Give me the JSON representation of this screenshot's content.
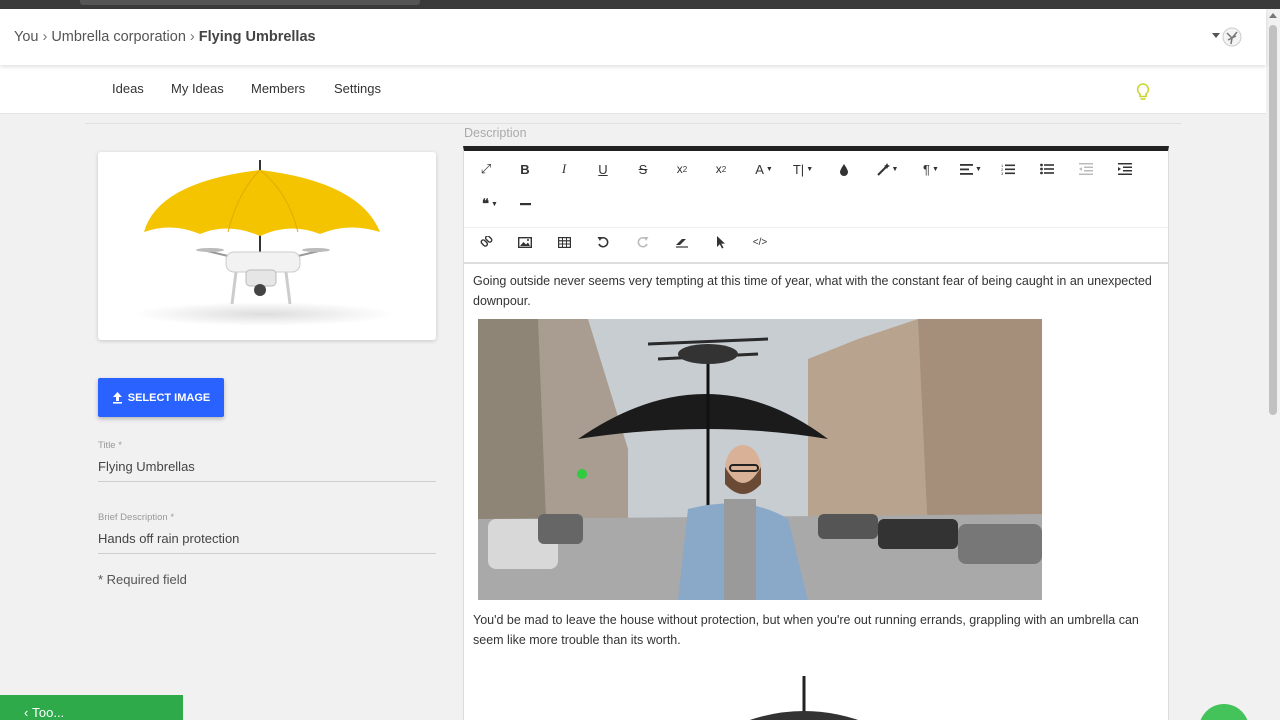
{
  "breadcrumb": {
    "items": [
      "You",
      "Umbrella corporation"
    ],
    "separator": "›",
    "current": "Flying Umbrellas"
  },
  "tabs": [
    {
      "label": "Ideas"
    },
    {
      "label": "My Ideas"
    },
    {
      "label": "Members"
    },
    {
      "label": "Settings"
    }
  ],
  "form": {
    "select_image_label": "SELECT IMAGE",
    "title": {
      "label": "Title *",
      "value": "Flying Umbrellas"
    },
    "brief": {
      "label": "Brief Description *",
      "value": "Hands off rain protection"
    },
    "required_note": "* Required field"
  },
  "editor": {
    "label": "Description",
    "paragraph1": "Going outside never seems very tempting at this time of year, what with the constant fear of being caught in an unexpected downpour.",
    "paragraph2": "You'd be mad to leave the house without protection, but when you're out running errands, grappling with an umbrella can seem like more trouble than its worth."
  },
  "bottom": {
    "green_button_label": "‹  Тоо..."
  },
  "colors": {
    "primary": "#2962ff",
    "accent_green": "#2eaa4b",
    "bulb": "#c6d62b",
    "editor_border": "#222222"
  }
}
